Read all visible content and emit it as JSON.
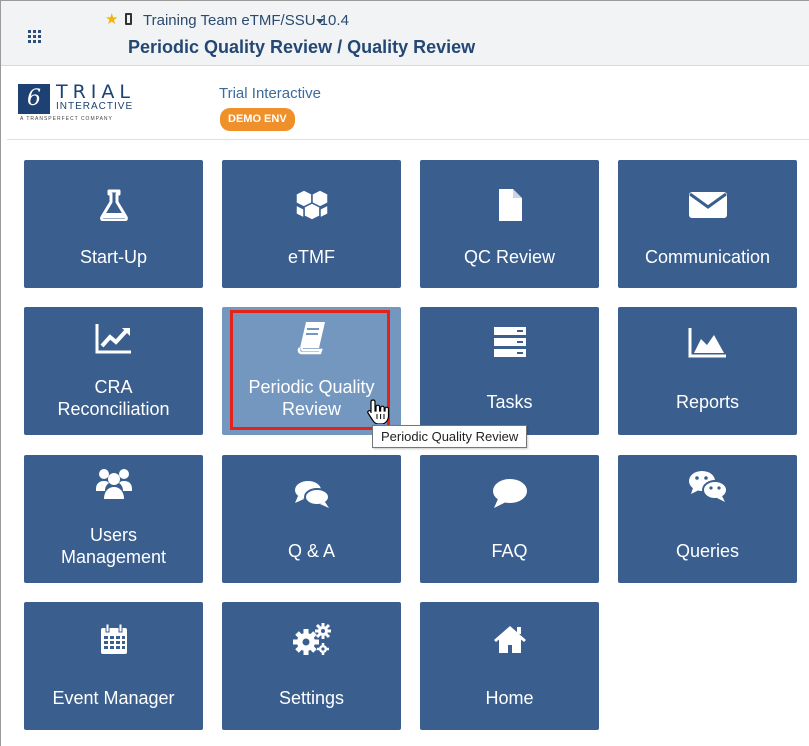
{
  "header": {
    "apps_icon": "grid-icon",
    "favorite_icon": "star-icon",
    "device_icon": "phone-icon",
    "study_title": "Training Team eTMF/SSU 10.4",
    "dropdown_icon": "caret-down-icon",
    "page_title": "Periodic Quality Review / Quality Review"
  },
  "brand": {
    "logo_mark": "6",
    "logo_trial": "TRIAL",
    "logo_interactive": "INTERACTIVE",
    "logo_company": "A TRANSPERFECT COMPANY",
    "org_name": "Trial Interactive",
    "env_badge": "DEMO ENV"
  },
  "tiles": [
    {
      "label": "Start-Up",
      "icon": "flask-icon"
    },
    {
      "label": "eTMF",
      "icon": "cubes-icon"
    },
    {
      "label": "QC Review",
      "icon": "file-icon"
    },
    {
      "label": "Communication",
      "icon": "envelope-icon"
    },
    {
      "label": "CRA\nReconciliation",
      "icon": "line-chart-icon"
    },
    {
      "label": "Periodic Quality\nReview",
      "icon": "book-icon",
      "active": true
    },
    {
      "label": "Tasks",
      "icon": "server-icon"
    },
    {
      "label": "Reports",
      "icon": "area-chart-icon"
    },
    {
      "label": "Users\nManagement",
      "icon": "users-icon"
    },
    {
      "label": "Q & A",
      "icon": "comments-icon"
    },
    {
      "label": "FAQ",
      "icon": "comment-icon"
    },
    {
      "label": "Queries",
      "icon": "wechat-icon"
    },
    {
      "label": "Event Manager",
      "icon": "calendar-icon"
    },
    {
      "label": "Settings",
      "icon": "gears-icon"
    },
    {
      "label": "Home",
      "icon": "home-icon"
    }
  ],
  "tooltip": "Periodic Quality Review",
  "colors": {
    "tile_bg": "#3a5f8f",
    "tile_active_bg": "#7497bf",
    "highlight_border": "#e2231a",
    "badge_bg": "#f0902a",
    "title_color": "#244873"
  }
}
